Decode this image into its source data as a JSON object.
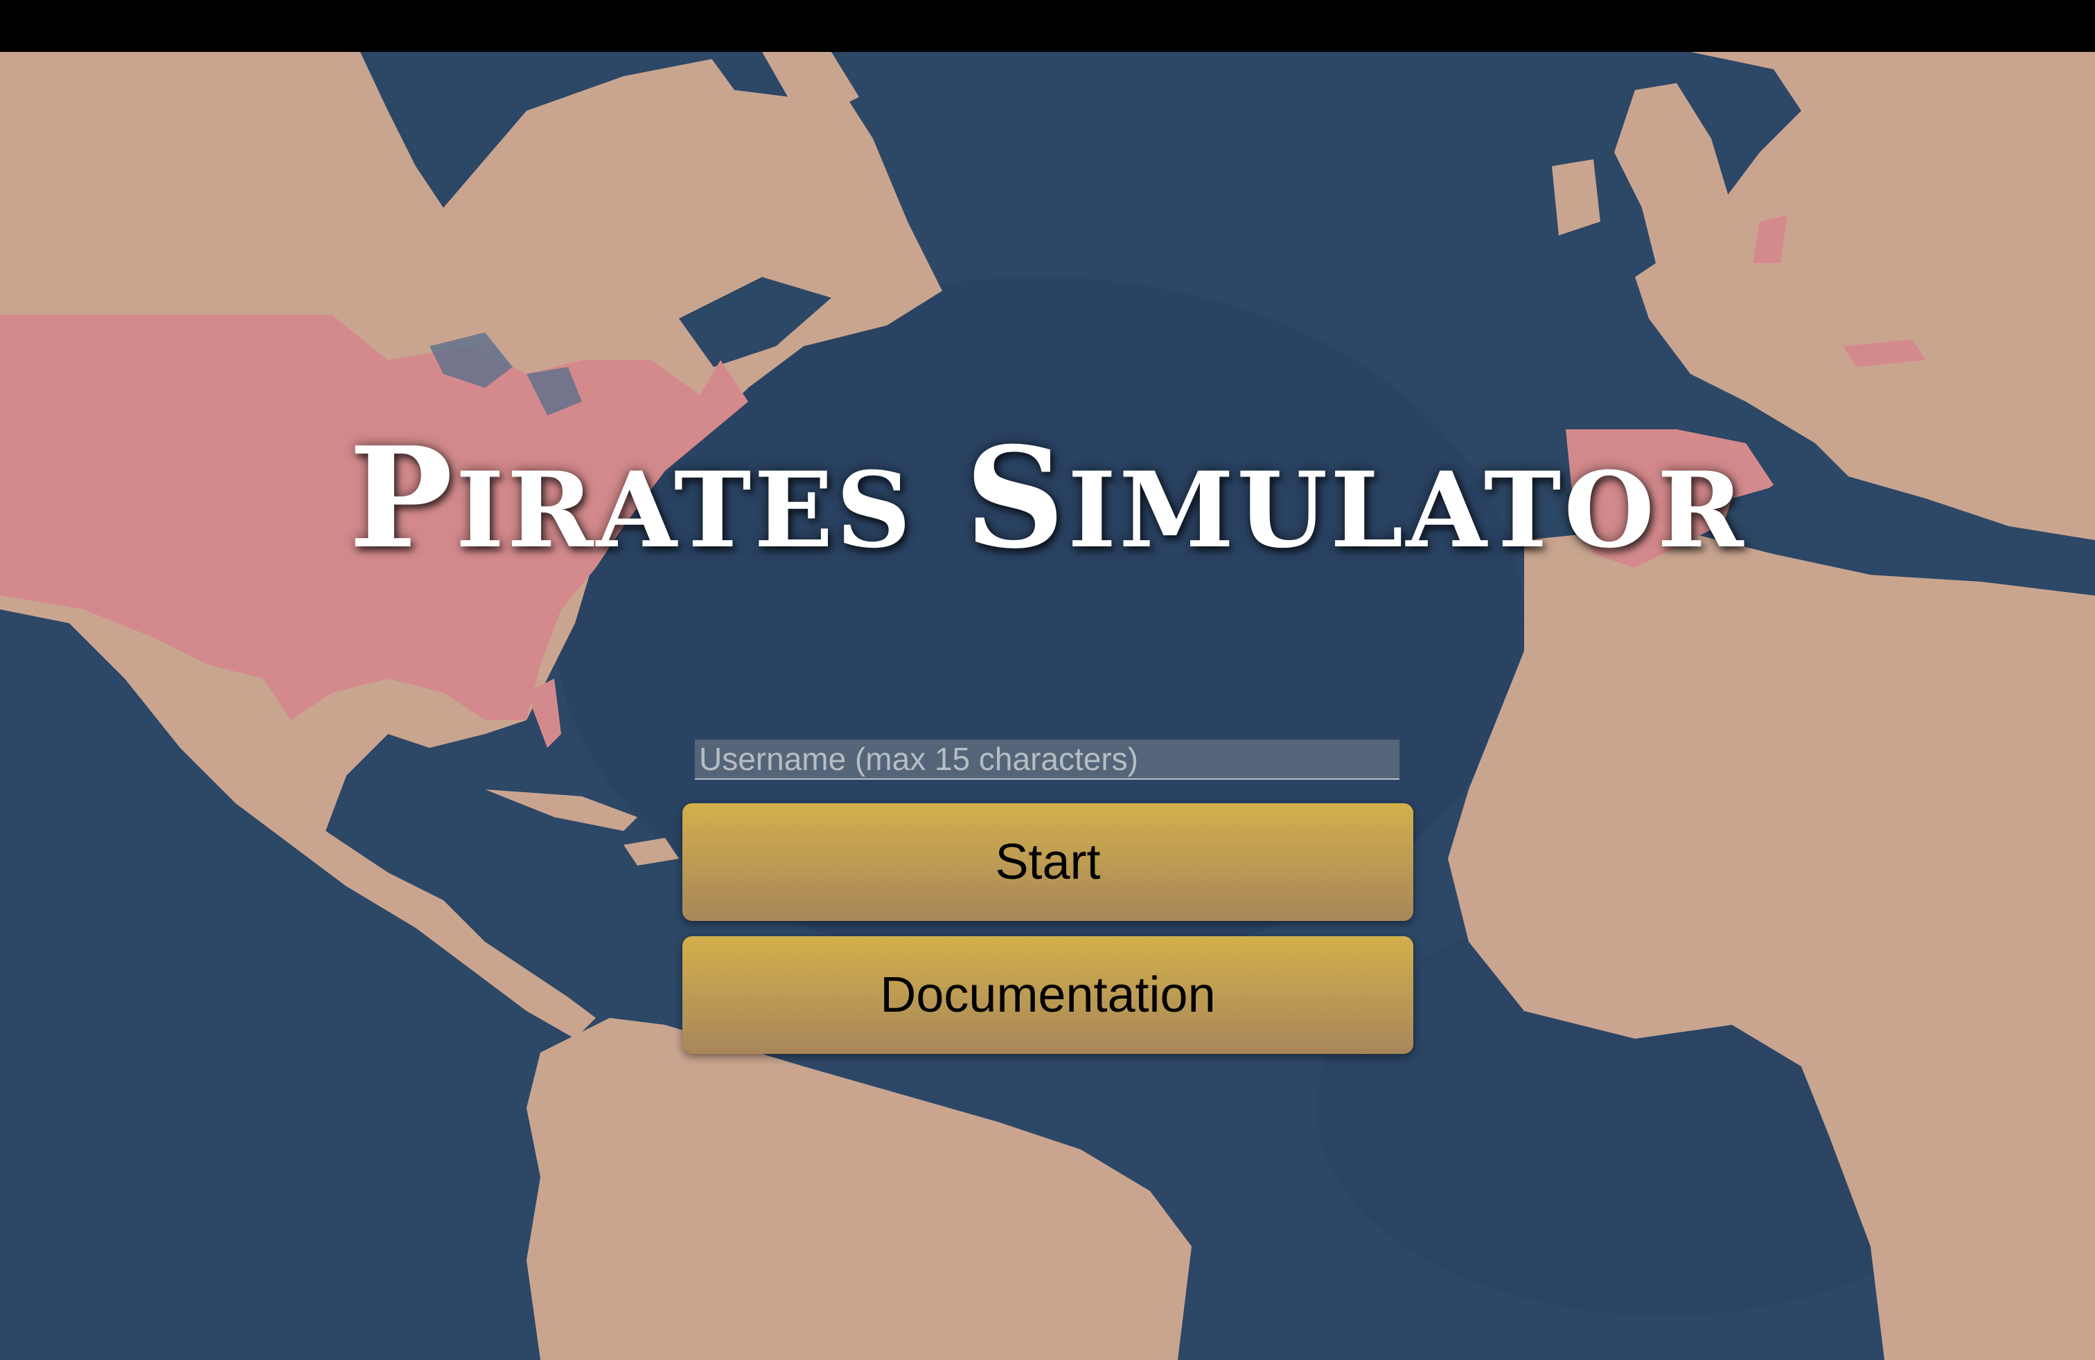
{
  "title": {
    "word1_initial": "P",
    "word1_rest": "IRATES",
    "word2_initial": "S",
    "word2_rest": "IMULATOR"
  },
  "menu": {
    "username_placeholder": "Username (max 15 characters)",
    "start_label": "Start",
    "documentation_label": "Documentation"
  },
  "colors": {
    "ocean": "#2d4766",
    "land": "#c9a590",
    "highlighted_country": "#d48a8c",
    "button_top": "#d2b04c",
    "button_bottom": "#a8865a"
  }
}
